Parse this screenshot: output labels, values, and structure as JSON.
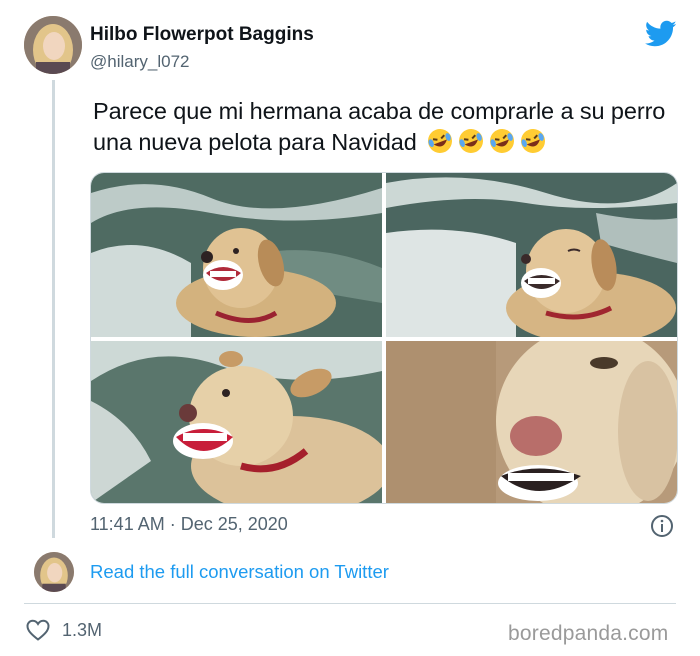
{
  "author": {
    "name": "Hilbo Flowerpot Baggins",
    "handle": "@hilary_l072"
  },
  "tweet": {
    "text": "Parece que mi hermana acaba de comprarle a su perro una nueva pelota para Navidad",
    "emojis": [
      "rolling-on-floor-laughing",
      "rolling-on-floor-laughing",
      "rolling-on-floor-laughing",
      "rolling-on-floor-laughing"
    ],
    "timestamp": "11:41 AM · Dec 25, 2020",
    "media_count": 4
  },
  "footer": {
    "read_link": "Read the full conversation on Twitter",
    "like_count": "1.3M"
  },
  "watermark": "boredpanda.com",
  "colors": {
    "link_blue": "#1d9bf0",
    "muted": "#536471",
    "twitter_blue": "#1d9bf0",
    "border": "#cfd9de"
  },
  "icons": {
    "brand": "twitter-bird-icon",
    "info": "info-icon",
    "like": "heart-icon"
  }
}
